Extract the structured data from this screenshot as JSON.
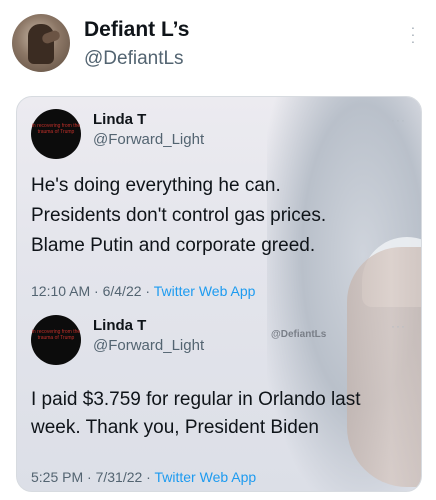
{
  "poster": {
    "display_name": "Defiant L’s",
    "handle": "@DefiantLs"
  },
  "icons": {
    "more": "more-vertical-icon",
    "quoted_more": "more-horizontal-icon"
  },
  "quoted_tweets": [
    {
      "name": "Linda T",
      "handle": "@Forward_Light",
      "avatar_text": "in recovering from the trauma of Trump",
      "text_lines": [
        "He's doing everything he can.",
        "Presidents don't control gas prices.",
        "Blame Putin and corporate greed."
      ],
      "time_date": "12:10 AM · 6/4/22 · ",
      "source": "Twitter Web App"
    },
    {
      "name": "Linda T",
      "handle": "@Forward_Light",
      "avatar_text": "in recovering from the trauma of Trump",
      "text_lines": [
        "I paid $3.759 for regular in Orlando last",
        "week. Thank you, President Biden"
      ],
      "time_date": "5:25 PM · 7/31/22 · ",
      "source": "Twitter Web App"
    }
  ],
  "watermark": "@DefiantLs"
}
